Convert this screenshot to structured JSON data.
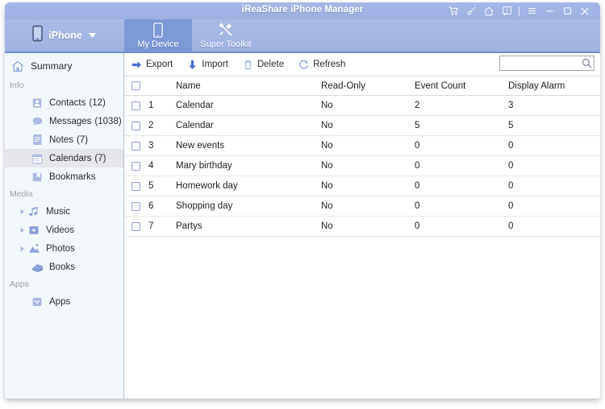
{
  "window": {
    "title": "iReaShare iPhone Manager",
    "controls": [
      {
        "name": "cart-icon",
        "label": "Cart"
      },
      {
        "name": "key-icon",
        "label": "Register"
      },
      {
        "name": "home-icon",
        "label": "Home"
      },
      {
        "name": "help-icon",
        "label": "Help"
      },
      {
        "name": "menu-icon",
        "label": "Menu"
      },
      {
        "name": "minimize-icon",
        "label": "Minimize"
      },
      {
        "name": "maximize-icon",
        "label": "Maximize"
      },
      {
        "name": "close-icon",
        "label": "Close"
      }
    ]
  },
  "navbar": {
    "device": {
      "label": "iPhone",
      "icon": "phone-icon",
      "caret": "chevron-down-icon"
    },
    "tabs": [
      {
        "label": "My Device",
        "icon": "device-icon",
        "active": true
      },
      {
        "label": "Super Toolkit",
        "icon": "toolkit-icon",
        "active": false
      }
    ]
  },
  "sidebar": {
    "summary": {
      "label": "Summary",
      "icon": "home-icon"
    },
    "groups": [
      {
        "title": "Info",
        "items": [
          {
            "label": "Contacts",
            "count": "(12)",
            "icon": "contacts-icon",
            "selected": false,
            "expandable": false
          },
          {
            "label": "Messages",
            "count": "(1038)",
            "icon": "messages-icon",
            "selected": false,
            "expandable": false
          },
          {
            "label": "Notes",
            "count": "(7)",
            "icon": "notes-icon",
            "selected": false,
            "expandable": false
          },
          {
            "label": "Calendars",
            "count": "(7)",
            "icon": "calendar-icon",
            "selected": true,
            "expandable": false
          },
          {
            "label": "Bookmarks",
            "count": "",
            "icon": "bookmarks-icon",
            "selected": false,
            "expandable": false
          }
        ]
      },
      {
        "title": "Media",
        "items": [
          {
            "label": "Music",
            "count": "",
            "icon": "music-icon",
            "selected": false,
            "expandable": true
          },
          {
            "label": "Videos",
            "count": "",
            "icon": "videos-icon",
            "selected": false,
            "expandable": true
          },
          {
            "label": "Photos",
            "count": "",
            "icon": "photos-icon",
            "selected": false,
            "expandable": true
          },
          {
            "label": "Books",
            "count": "",
            "icon": "books-icon",
            "selected": false,
            "expandable": false
          }
        ]
      },
      {
        "title": "Apps",
        "items": [
          {
            "label": "Apps",
            "count": "",
            "icon": "apps-icon",
            "selected": false,
            "expandable": false
          }
        ]
      }
    ]
  },
  "toolbar": {
    "buttons": [
      {
        "label": "Export",
        "icon": "export-arrow-icon"
      },
      {
        "label": "Import",
        "icon": "import-arrow-icon"
      },
      {
        "label": "Delete",
        "icon": "trash-icon"
      },
      {
        "label": "Refresh",
        "icon": "refresh-icon"
      }
    ],
    "search": {
      "value": "",
      "placeholder": "",
      "icon": "search-icon"
    }
  },
  "table": {
    "headers": [
      "",
      "",
      "Name",
      "Read-Only",
      "Event Count",
      "Display Alarm"
    ],
    "header_checkbox_checked": false,
    "rows": [
      {
        "index": "1",
        "name": "Calendar",
        "read_only": "No",
        "event_count": "2",
        "display_alarm": "3",
        "checked": false
      },
      {
        "index": "2",
        "name": "Calendar",
        "read_only": "No",
        "event_count": "5",
        "display_alarm": "5",
        "checked": false
      },
      {
        "index": "3",
        "name": "New events",
        "read_only": "No",
        "event_count": "0",
        "display_alarm": "0",
        "checked": false
      },
      {
        "index": "4",
        "name": "Mary birthday",
        "read_only": "No",
        "event_count": "0",
        "display_alarm": "0",
        "checked": false
      },
      {
        "index": "5",
        "name": "Homework day",
        "read_only": "No",
        "event_count": "0",
        "display_alarm": "0",
        "checked": false
      },
      {
        "index": "6",
        "name": "Shopping day",
        "read_only": "No",
        "event_count": "0",
        "display_alarm": "0",
        "checked": false
      },
      {
        "index": "7",
        "name": "Partys",
        "read_only": "No",
        "event_count": "0",
        "display_alarm": "0",
        "checked": false
      }
    ]
  },
  "colors": {
    "titlebar": "#9fb2e3",
    "navbar": "#a5b6e5",
    "tab_active": "#7e98d8",
    "nav_underline": "#6f8fd0",
    "sidebar_bg": "#f3f8fc",
    "sidebar_selected": "#e4e6e9",
    "icon_blue": "#93a6de",
    "checkbox_border": "#8f9fd4"
  }
}
